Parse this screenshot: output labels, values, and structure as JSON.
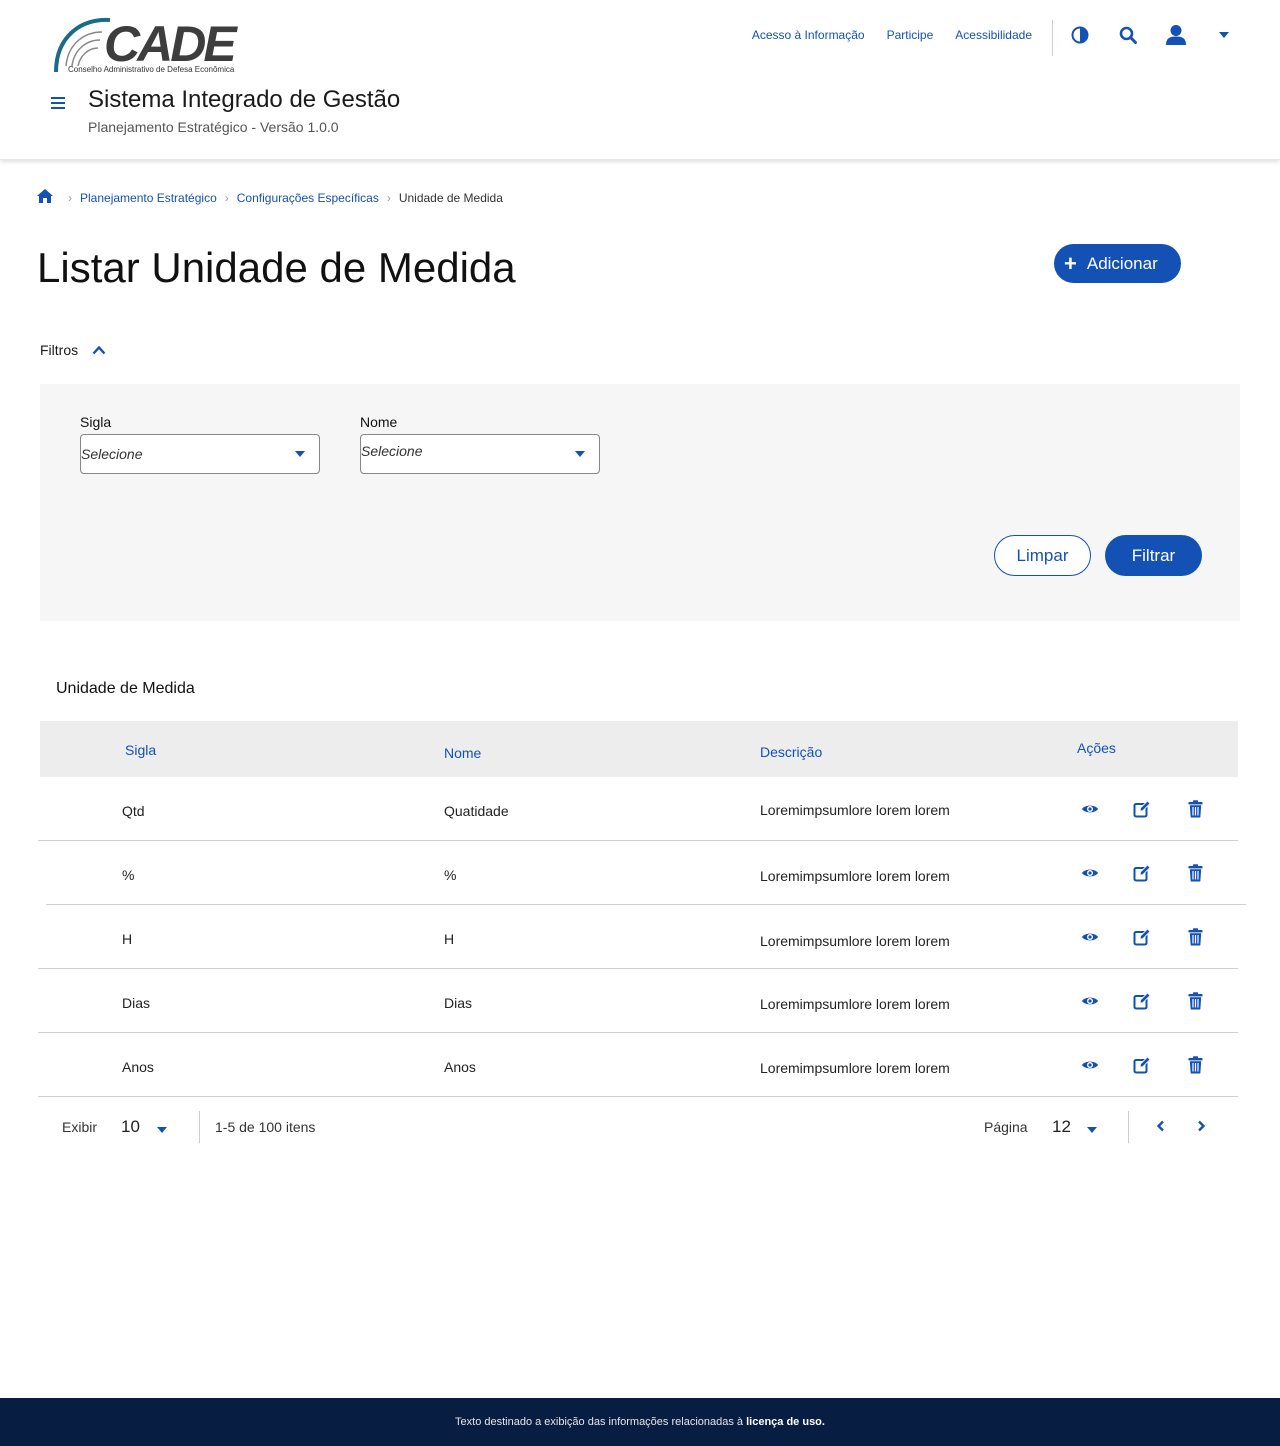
{
  "header": {
    "logo_text": "CADE",
    "logo_subtitle": "Conselho Administrativo de Defesa Econômica",
    "links": [
      "Acesso à Informação",
      "Participe",
      "Acessibilidade"
    ],
    "system_title": "Sistema Integrado de Gestão",
    "system_subtitle": "Planejamento Estratégico - Versão 1.0.0",
    "icons": [
      "contrast-icon",
      "search-icon",
      "user-icon",
      "caret-down-icon"
    ]
  },
  "breadcrumb": {
    "items": [
      "Planejamento Estratégico",
      "Configurações Específicas",
      "Unidade de Medida"
    ]
  },
  "page": {
    "title": "Listar Unidade de Medida",
    "add_label": "Adicionar"
  },
  "filters": {
    "toggle_label": "Filtros",
    "fields": [
      {
        "label": "Sigla",
        "placeholder": "Selecione"
      },
      {
        "label": "Nome",
        "placeholder": "Selecione"
      }
    ],
    "clear_label": "Limpar",
    "filter_label": "Filtrar"
  },
  "table": {
    "title": "Unidade de Medida",
    "columns": [
      "Sigla",
      "Nome",
      "Descrição",
      "Ações"
    ],
    "rows": [
      {
        "sigla": "Qtd",
        "nome": "Quatidade",
        "descricao": "Loremimpsumlore lorem lorem"
      },
      {
        "sigla": "%",
        "nome": "%",
        "descricao": "Loremimpsumlore lorem lorem"
      },
      {
        "sigla": "H",
        "nome": "H",
        "descricao": "Loremimpsumlore lorem lorem"
      },
      {
        "sigla": "Dias",
        "nome": "Dias",
        "descricao": "Loremimpsumlore lorem lorem"
      },
      {
        "sigla": "Anos",
        "nome": "Anos",
        "descricao": "Loremimpsumlore lorem lorem"
      }
    ],
    "actions": [
      "view-icon",
      "edit-icon",
      "delete-icon"
    ]
  },
  "pagination": {
    "show_label": "Exibir",
    "page_size": "10",
    "range_text": "1-5 de 100 itens",
    "page_label": "Página",
    "page_value": "12"
  },
  "footer": {
    "text": "Texto destinado a exibição das informações relacionadas à ",
    "bold": "licença de uso."
  },
  "colors": {
    "primary": "#1351b4",
    "footer_bg": "#071d41",
    "panel_bg": "#f6f6f6"
  }
}
